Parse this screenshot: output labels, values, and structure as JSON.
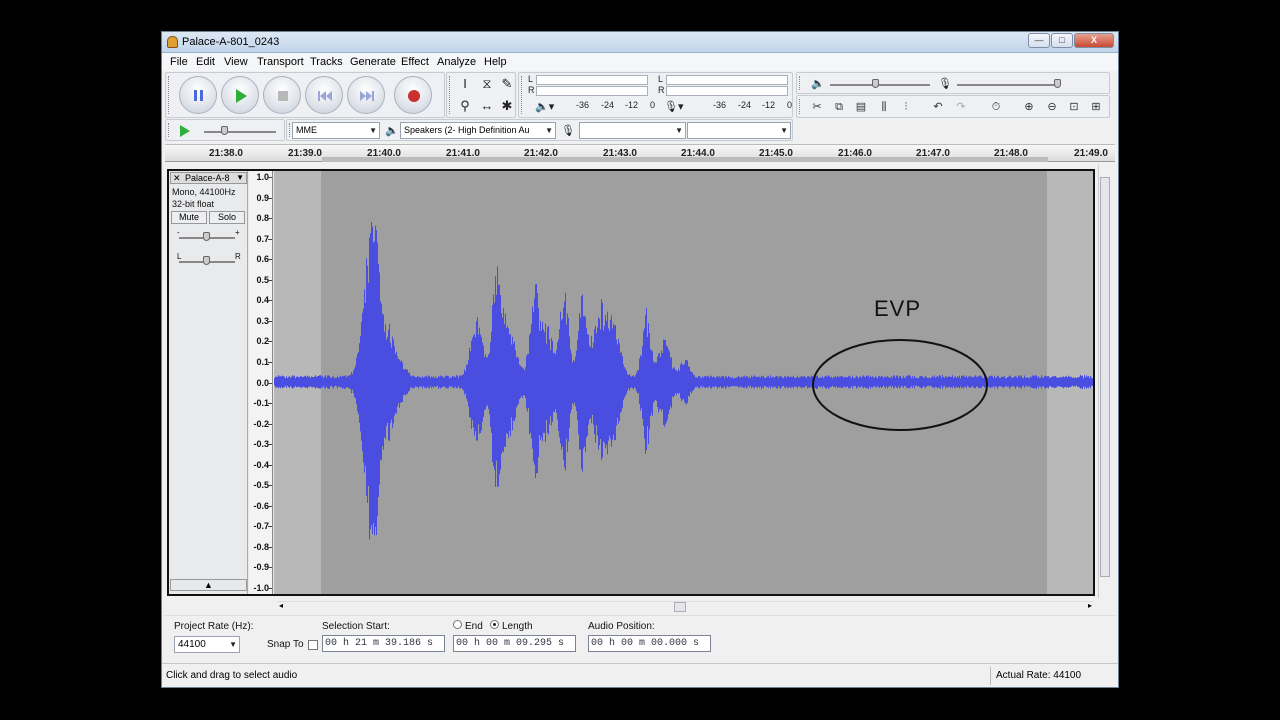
{
  "window": {
    "title": "Palace-A-801_0243",
    "minimize": "—",
    "maximize": "□",
    "close": "X"
  },
  "menu": [
    "File",
    "Edit",
    "View",
    "Transport",
    "Tracks",
    "Generate",
    "Effect",
    "Analyze",
    "Help"
  ],
  "meters": {
    "playback": {
      "l": "L",
      "r": "R",
      "db": [
        "-36",
        "-24",
        "-12",
        "0"
      ]
    },
    "record": {
      "l": "L",
      "r": "R",
      "db": [
        "-36",
        "-24",
        "-12",
        "0"
      ]
    }
  },
  "device": {
    "host": "MME",
    "output": "Speakers (2- High Definition Au",
    "input": "",
    "channels": ""
  },
  "ruler": {
    "ticks": [
      "21:38.0",
      "21:39.0",
      "21:40.0",
      "21:41.0",
      "21:42.0",
      "21:43.0",
      "21:44.0",
      "21:45.0",
      "21:46.0",
      "21:47.0",
      "21:48.0",
      "21:49.0"
    ]
  },
  "track": {
    "name": "Palace-A-8",
    "format": "Mono, 44100Hz",
    "bits": "32-bit float",
    "mute": "Mute",
    "solo": "Solo",
    "gain_minus": "-",
    "gain_plus": "+",
    "pan_l": "L",
    "pan_r": "R",
    "collapse": "▲"
  },
  "amplitude_scale": [
    "1.0",
    "0.9",
    "0.8",
    "0.7",
    "0.6",
    "0.5",
    "0.4",
    "0.3",
    "0.2",
    "0.1",
    "0.0",
    "-0.1",
    "-0.2",
    "-0.3",
    "-0.4",
    "-0.5",
    "-0.6",
    "-0.7",
    "-0.8",
    "-0.9",
    "-1.0"
  ],
  "annotation": {
    "label": "EVP"
  },
  "selection": {
    "project_rate_label": "Project Rate (Hz):",
    "project_rate": "44100",
    "snap_to": "Snap To",
    "start_label": "Selection Start:",
    "start": "00 h 21 m 39.186 s",
    "end_label": "End",
    "length_label": "Length",
    "length": "00 h 00 m 09.295 s",
    "position_label": "Audio Position:",
    "position": "00 h 00 m 00.000 s",
    "length_mode": "Length"
  },
  "status": {
    "left": "Click and drag to select audio",
    "right": "Actual Rate: 44100"
  },
  "colors": {
    "waveform": "#4a4ee0",
    "selection": "#9f9f9f",
    "background": "#b8b8b8"
  }
}
